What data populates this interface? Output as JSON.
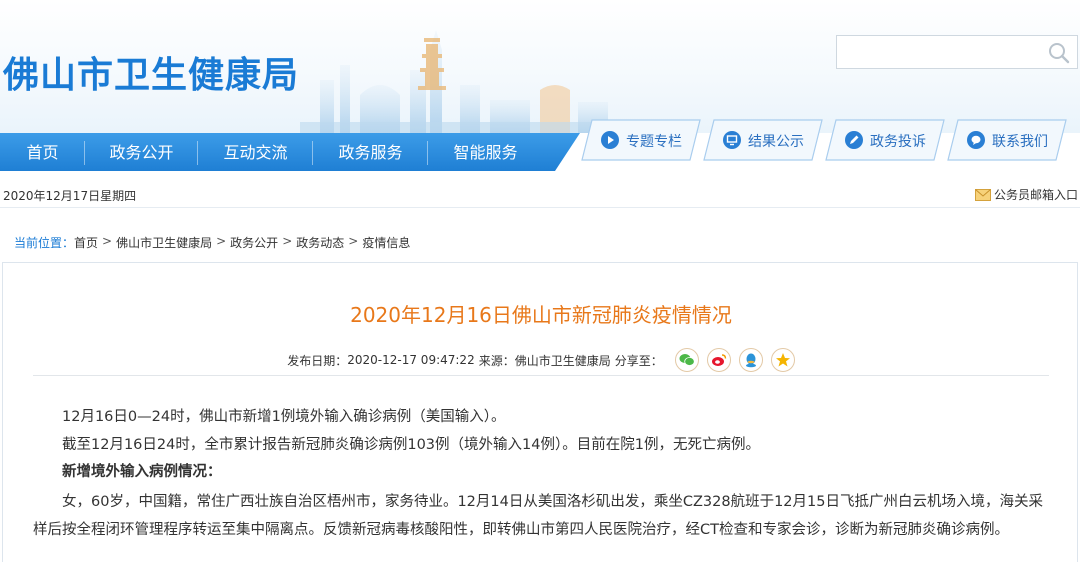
{
  "header": {
    "site_title": "佛山市卫生健康局",
    "search_placeholder": ""
  },
  "nav": {
    "items": [
      "首页",
      "政务公开",
      "互动交流",
      "政务服务",
      "智能服务"
    ],
    "quick_links": [
      {
        "label": "专题专栏",
        "icon": "play-circle-icon"
      },
      {
        "label": "结果公示",
        "icon": "monitor-icon"
      },
      {
        "label": "政务投诉",
        "icon": "pen-circle-icon"
      },
      {
        "label": "联系我们",
        "icon": "chat-bubble-icon"
      }
    ]
  },
  "date_bar": {
    "date": "2020年12月17日星期四",
    "mailbox": "公务员邮箱入口"
  },
  "breadcrumb": {
    "prefix": "当前位置：",
    "items": [
      "首页",
      "佛山市卫生健康局",
      "政务公开",
      "政务动态",
      "疫情信息"
    ],
    "separator": ">"
  },
  "article": {
    "title": "2020年12月16日佛山市新冠肺炎疫情情况",
    "publish_label": "发布日期：",
    "publish_date": "2020-12-17 09:47:22",
    "source_label": "来源：",
    "source": "佛山市卫生健康局",
    "share_label": "分享至：",
    "share_icons": [
      "wechat-icon",
      "weibo-icon",
      "qq-icon",
      "qzone-star-icon"
    ],
    "paragraphs": [
      "12月16日0—24时，佛山市新增1例境外输入确诊病例（美国输入）。",
      "截至12月16日24时，全市累计报告新冠肺炎确诊病例103例（境外输入14例）。目前在院1例，无死亡病例。",
      "新增境外输入病例情况：",
      "女，60岁，中国籍，常住广西壮族自治区梧州市，家务待业。12月14日从美国洛杉矶出发，乘坐CZ328航班于12月15日飞抵广州白云机场入境，海关采样后按全程闭环管理程序转运至集中隔离点。反馈新冠病毒核酸阳性，即转佛山市第四人民医院治疗，经CT检查和专家会诊，诊断为新冠肺炎确诊病例。"
    ]
  },
  "colors": {
    "brand_blue": "#1a7bd5",
    "nav_blue": "#2d8fe0",
    "title_orange": "#e8781a"
  }
}
